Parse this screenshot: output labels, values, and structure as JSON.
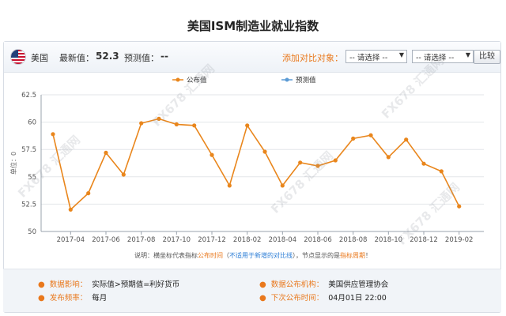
{
  "page": {
    "title": "美国ISM制造业就业指数"
  },
  "toolbar": {
    "country": "美国",
    "latest_label": "最新值：",
    "latest_value": "52.3",
    "forecast_label": "预测值：",
    "forecast_value": "--",
    "compare_label": "添加对比对象：",
    "select1": "-- 请选择 --",
    "select2": "-- 请选择 --",
    "compare_button": "比较"
  },
  "chart_data": {
    "type": "line",
    "title": "",
    "xlabel": "",
    "ylabel": "单位：0",
    "ylim": [
      50,
      62.5
    ],
    "yticks": [
      "50",
      "52.5",
      "55",
      "57.5",
      "60",
      "62.5"
    ],
    "x_tick_labels": [
      "2017-04",
      "2017-06",
      "2017-08",
      "2017-10",
      "2017-12",
      "2018-02",
      "2018-04",
      "2018-06",
      "2018-08",
      "2018-10",
      "2018-12",
      "2019-02"
    ],
    "legend": {
      "position": "top",
      "entries": [
        "公布值",
        "预测值"
      ]
    },
    "grid": {
      "horizontal": true,
      "vertical": false
    },
    "colors": {
      "actual": "#e9861c",
      "forecast": "#5b9bd5"
    },
    "series": [
      {
        "name": "公布值",
        "x": [
          "2017-03",
          "2017-04",
          "2017-05",
          "2017-06",
          "2017-07",
          "2017-08",
          "2017-09",
          "2017-10",
          "2017-11",
          "2017-12",
          "2018-01",
          "2018-02",
          "2018-03",
          "2018-04",
          "2018-05",
          "2018-06",
          "2018-07",
          "2018-08",
          "2018-09",
          "2018-10",
          "2018-11",
          "2018-12",
          "2019-01",
          "2019-02",
          "2019-03"
        ],
        "values": [
          58.9,
          52.0,
          53.5,
          57.2,
          55.2,
          59.9,
          60.3,
          59.8,
          59.7,
          57.0,
          54.2,
          59.7,
          57.3,
          54.2,
          56.3,
          56.0,
          56.5,
          58.5,
          58.8,
          56.8,
          58.4,
          56.2,
          55.5,
          52.3,
          null
        ],
        "note": ""
      },
      {
        "name": "预测值",
        "x": [],
        "values": []
      }
    ]
  },
  "note": {
    "prefix": "说明：横坐标代表指标",
    "hl1": "公布时间",
    "mid1": "（",
    "hl2": "不适用于新增的对比线",
    "mid2": "），节点显示的是",
    "hl3": "指标周期",
    "suffix": "！"
  },
  "info": {
    "impact_label": "数据影响：",
    "impact_value": "实际值>预期值=利好货币",
    "agency_label": "数据公布机构：",
    "agency_value": "美国供应管理协会",
    "freq_label": "发布频率：",
    "freq_value": "每月",
    "next_label": "下次公布时间：",
    "next_value": "04月01日 22:00"
  },
  "watermark": "FX678 汇通网"
}
